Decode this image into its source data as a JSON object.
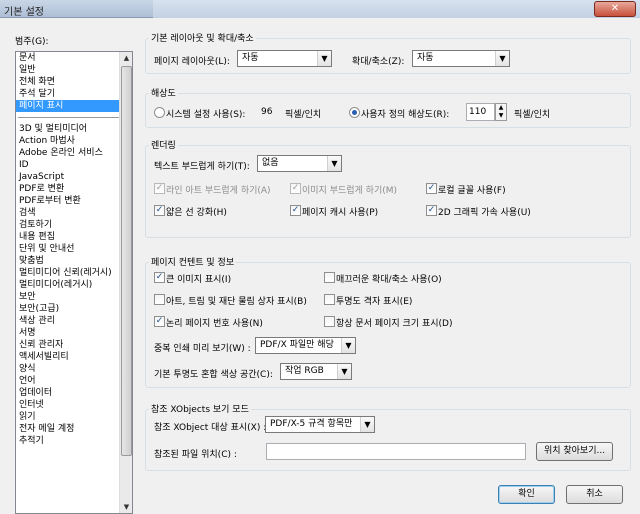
{
  "window": {
    "title": "기본 설정",
    "close_glyph": "✕"
  },
  "categories": {
    "label": "범주(G):",
    "group1": [
      "문서",
      "일반",
      "전체 화면",
      "주석 달기",
      "페이지 표시"
    ],
    "group2": [
      "3D 및 멀티미디어",
      "Action 마법사",
      "Adobe 온라인 서비스",
      "ID",
      "JavaScript",
      "PDF로 변환",
      "PDF로부터 변환",
      "검색",
      "검토하기",
      "내용 편집",
      "단위 및 안내선",
      "맞춤법",
      "멀티미디어 신뢰(레거시)",
      "멀티미디어(레거시)",
      "보안",
      "보안(고급)",
      "색상 관리",
      "서명",
      "신뢰 관리자",
      "액세서빌리티",
      "양식",
      "언어",
      "업데이터",
      "인터넷",
      "읽기",
      "전자 메일 계정",
      "추적기"
    ],
    "selected": "페이지 표시"
  },
  "layout": {
    "title": "기본 레이아웃 및 확대/축소",
    "page_layout_label": "페이지 레이아웃(L):",
    "page_layout_value": "자동",
    "zoom_label": "확대/축소(Z):",
    "zoom_value": "자동"
  },
  "resolution": {
    "title": "해상도",
    "system_label": "시스템 설정 사용(S):",
    "system_value": "96",
    "system_unit": "픽셀/인치",
    "custom_label": "사용자 정의 해상도(R):",
    "custom_value": "110",
    "custom_unit": "픽셀/인치",
    "selected": "custom"
  },
  "rendering": {
    "title": "렌더링",
    "smooth_text_label": "텍스트 부드럽게 하기(T):",
    "smooth_text_value": "없음",
    "smooth_line_art": {
      "label": "라인 아트 부드럽게 하기(A)",
      "checked": true,
      "enabled": false
    },
    "smooth_images": {
      "label": "이미지 부드럽게 하기(M)",
      "checked": true,
      "enabled": false
    },
    "local_fonts": {
      "label": "로컬 글꼴 사용(F)",
      "checked": true,
      "enabled": true
    },
    "thin_lines": {
      "label": "얇은 선 강화(H)",
      "checked": true,
      "enabled": true
    },
    "page_cache": {
      "label": "페이지 캐시 사용(P)",
      "checked": true,
      "enabled": true
    },
    "gpu_2d": {
      "label": "2D 그래픽 가속 사용(U)",
      "checked": true,
      "enabled": true
    }
  },
  "page_content": {
    "title": "페이지 컨텐트 및 정보",
    "large_images": {
      "label": "큰 이미지 표시(I)",
      "checked": true
    },
    "smooth_zoom": {
      "label": "매끄러운 확대/축소 사용(O)",
      "checked": false
    },
    "art_trim_bleed": {
      "label": "아트, 트림 및 재단 물림 상자 표시(B)",
      "checked": false
    },
    "transparency_grid": {
      "label": "투명도 격자 표시(E)",
      "checked": false
    },
    "logical_page_numbers": {
      "label": "논리 페이지 번호 사용(N)",
      "checked": true
    },
    "always_doc_page_size": {
      "label": "항상 문서 페이지 크기 표시(D)",
      "checked": false
    },
    "overprint_label": "중복 인쇄 미리 보기(W) :",
    "overprint_value": "PDF/X 파일만 해당",
    "blend_space_label": "기본 투명도 혼합 색상 공간(C):",
    "blend_space_value": "작업 RGB"
  },
  "xobjects": {
    "title": "참조 XObjects 보기 모드",
    "target_label": "참조 XObject 대상 표시(X) :",
    "target_value": "PDF/X-5 규격 항목만",
    "location_label": "참조된 파일 위치(C) :",
    "location_value": "",
    "browse_label": "위치 찾아보기..."
  },
  "footer": {
    "ok_label": "확인",
    "cancel_label": "취소"
  }
}
